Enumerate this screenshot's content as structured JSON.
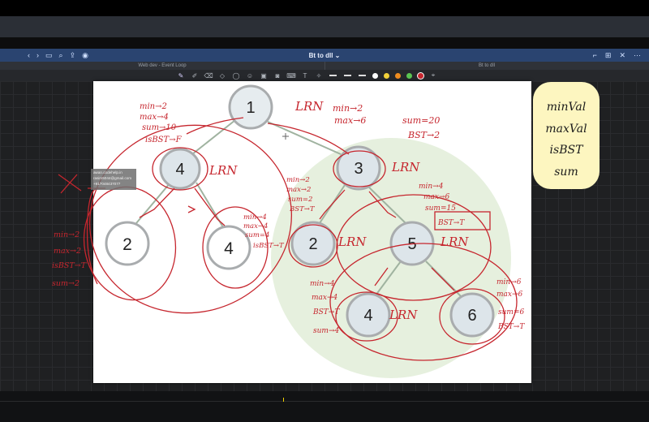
{
  "window": {
    "title": "Bt to dll",
    "tab_left": "Web dev - Event Loop",
    "tab_right": "Bt to dll"
  },
  "nodes": [
    "1",
    "4",
    "2",
    "4",
    "3",
    "2",
    "5",
    "4",
    "6"
  ],
  "labels": {
    "lrn": "LRN"
  },
  "annotations": {
    "top_left": [
      "min→2",
      "max→4",
      "sum→10",
      "isBST→F"
    ],
    "top_right": [
      "min→2",
      "max→6",
      "sum=20",
      "BST→2"
    ],
    "mid_left": [
      "min→2",
      "max→2",
      "sum=2",
      "BST→T"
    ],
    "mid_mid": [
      "min→4",
      "max→4",
      "sum=4",
      "isBST→T"
    ],
    "mid_right": [
      "min→4",
      "max→6",
      "sum=15",
      "BST→T"
    ],
    "low_left": [
      "min→4",
      "max→4",
      "BST→T",
      "sum→4"
    ],
    "low_right": [
      "min→6",
      "max→6",
      "sum=6",
      "BST→T"
    ],
    "far_left": [
      "min→2",
      "max→2",
      "isBST→T",
      "sum→2"
    ]
  },
  "sticky": [
    "minVal",
    "maxVal",
    "isBST",
    "sum"
  ],
  "tooltip": [
    "awan.codehelp.in",
    "rasim5044@gmail.com",
    "+917048437077"
  ],
  "colors": {
    "ink": "#c6262e",
    "node_fill": "#dde5ea",
    "node_stroke": "#a9acae",
    "highlight": "#e6f0de",
    "sticky_ink": "#1b1b1b",
    "toolbar_blue": "#2a4470"
  }
}
